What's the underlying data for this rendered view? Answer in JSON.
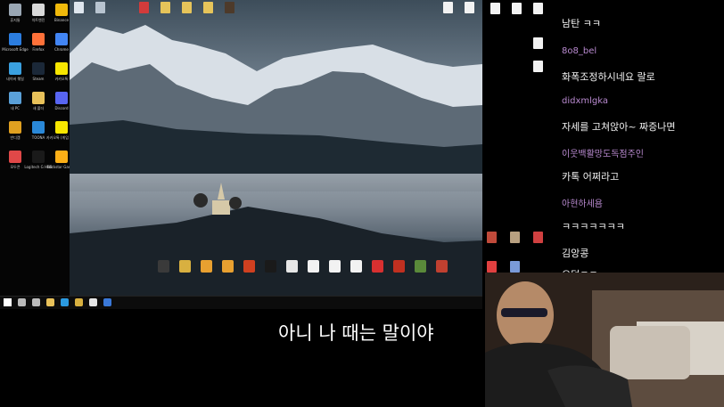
{
  "desktop_left_icons": [
    {
      "label": "휴지통",
      "color": "#9aa7b4"
    },
    {
      "label": "치트엔진",
      "color": "#d9d9d9"
    },
    {
      "label": "Binance",
      "color": "#f0b90b"
    },
    {
      "label": "Microsoft Edge",
      "color": "#2b7de0"
    },
    {
      "label": "Firefox",
      "color": "#ff7139"
    },
    {
      "label": "Chrome",
      "color": "#4285f4"
    },
    {
      "label": "네이버 웨일",
      "color": "#3aa0e0"
    },
    {
      "label": "Steam",
      "color": "#1b2838"
    },
    {
      "label": "카카오톡",
      "color": "#f7e600"
    },
    {
      "label": "내 PC",
      "color": "#5aa0d8"
    },
    {
      "label": "새 폴더",
      "color": "#e8c15a"
    },
    {
      "label": "Discord",
      "color": "#5865f2"
    },
    {
      "label": "반디캠",
      "color": "#e0a020"
    },
    {
      "label": "TOONA",
      "color": "#2a88d8"
    },
    {
      "label": "카카오톡 (게임 연동)",
      "color": "#f7e600"
    },
    {
      "label": "모두콘",
      "color": "#e04848"
    },
    {
      "label": "Logitech G HUB",
      "color": "#1a1a1a"
    },
    {
      "label": "Rockstar Games",
      "color": "#fcaf17"
    }
  ],
  "desktop_top_icons": [
    {
      "label": "",
      "color": "#dfe6ee"
    },
    {
      "label": "",
      "color": "#b8c4d0"
    },
    {
      "label": "",
      "color": "#d23b3b"
    },
    {
      "label": "",
      "color": "#e6c45a"
    },
    {
      "label": "",
      "color": "#e6c45a"
    },
    {
      "label": "",
      "color": "#e6c45a"
    },
    {
      "label": "",
      "color": "#4d3a2a"
    },
    {
      "label": "",
      "color": "#f2f2f2"
    },
    {
      "label": "",
      "color": "#f2f2f2"
    },
    {
      "label": "",
      "color": "#8a5ad8"
    }
  ],
  "desktop_bottom_icons": [
    {
      "label": "",
      "color": "#3a3a3a"
    },
    {
      "label": "",
      "color": "#d8b040"
    },
    {
      "label": "",
      "color": "#e8a030"
    },
    {
      "label": "",
      "color": "#e8a030"
    },
    {
      "label": "",
      "color": "#d04020"
    },
    {
      "label": "",
      "color": "#1a1a1a"
    },
    {
      "label": "",
      "color": "#e6e6e6"
    },
    {
      "label": "",
      "color": "#f2f2f2"
    },
    {
      "label": "",
      "color": "#f2f2f2"
    },
    {
      "label": "",
      "color": "#f2f2f2"
    },
    {
      "label": "",
      "color": "#d83030"
    },
    {
      "label": "",
      "color": "#c03020"
    },
    {
      "label": "",
      "color": "#5a8a3a"
    },
    {
      "label": "",
      "color": "#c04030"
    }
  ],
  "desktop_right_icons": [
    {
      "label": "",
      "color": "#f2f2f2"
    },
    {
      "label": "",
      "color": "#f2f2f2"
    },
    {
      "label": "",
      "color": "#f2f2f2"
    },
    {
      "label": "",
      "color": "#f2f2f2"
    },
    {
      "label": "",
      "color": "#f2f2f2"
    },
    {
      "label": "",
      "color": "#c04a3a"
    },
    {
      "label": "",
      "color": "#b8a080"
    },
    {
      "label": "",
      "color": "#d04040"
    },
    {
      "label": "",
      "color": "#e04040"
    },
    {
      "label": "",
      "color": "#7a9ad8"
    }
  ],
  "taskbar": {
    "items": [
      {
        "name": "start",
        "color": "#ffffff"
      },
      {
        "name": "search",
        "color": "#bbbbbb"
      },
      {
        "name": "task-view",
        "color": "#bbbbbb"
      },
      {
        "name": "explorer",
        "color": "#e8c15a"
      },
      {
        "name": "edge",
        "color": "#2b9ae0"
      },
      {
        "name": "app",
        "color": "#d8b040"
      },
      {
        "name": "app2",
        "color": "#e6e6e6"
      },
      {
        "name": "app3",
        "color": "#3a78d8"
      }
    ]
  },
  "chat": {
    "messages": [
      {
        "user": "",
        "text": "남탄 ㅋㅋ"
      },
      {
        "user": "8o8_bel",
        "text": ""
      },
      {
        "user": "",
        "text": "화폭조정하시네요 랄로"
      },
      {
        "user": "didxmlgka",
        "text": ""
      },
      {
        "user": "",
        "text": "자세를 고쳐앉아~ 짜증나면"
      },
      {
        "user": "이웃백활망도독점주인",
        "text": ""
      },
      {
        "user": "",
        "text": "카톡 어쩌라고"
      },
      {
        "user": "아현하세욤",
        "text": ""
      },
      {
        "user": "",
        "text": "ㅋㅋㅋㅋㅋㅋㅋ"
      },
      {
        "user": "",
        "text": "김앙콩"
      },
      {
        "user": "",
        "text": "오덕ㅋㅋ"
      }
    ]
  },
  "subtitle": "아니 나 때는 말이야"
}
